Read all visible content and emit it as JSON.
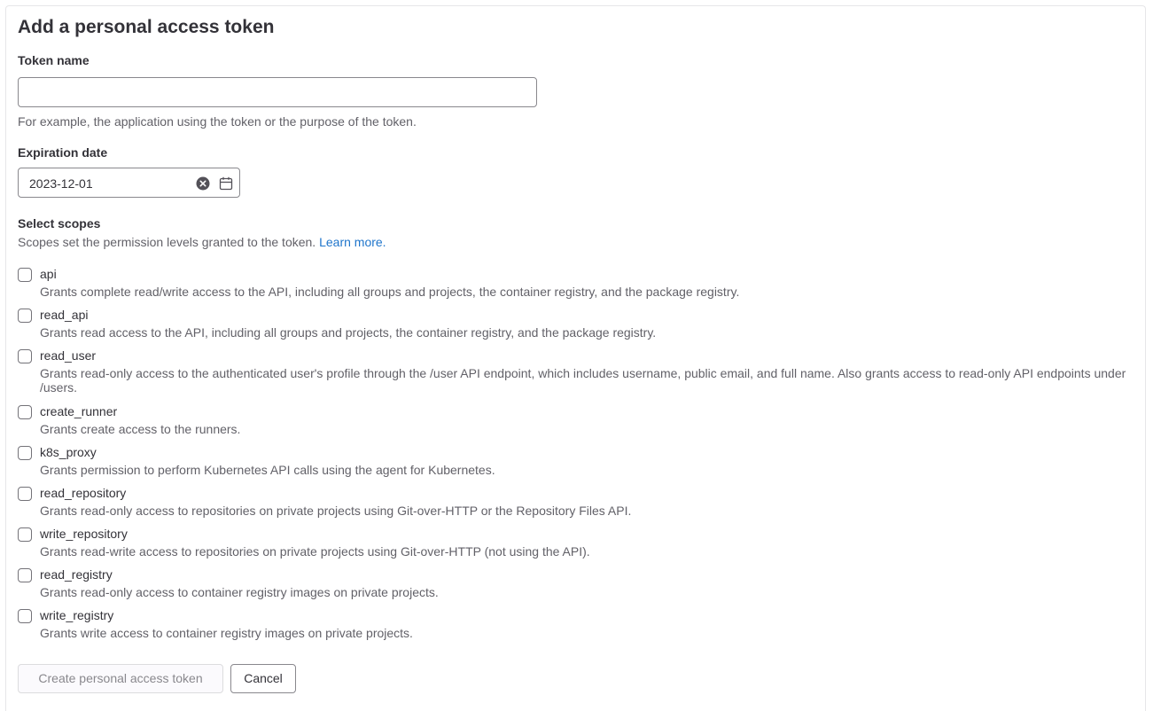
{
  "form": {
    "title": "Add a personal access token",
    "token_name": {
      "label": "Token name",
      "value": "",
      "help": "For example, the application using the token or the purpose of the token."
    },
    "expiration": {
      "label": "Expiration date",
      "value": "2023-12-01",
      "clear_icon": "clear-circle-icon",
      "calendar_icon": "calendar-icon"
    },
    "scopes": {
      "label": "Select scopes",
      "help": "Scopes set the permission levels granted to the token.",
      "learn_more": "Learn more.",
      "items": [
        {
          "name": "api",
          "checked": false,
          "desc": "Grants complete read/write access to the API, including all groups and projects, the container registry, and the package registry."
        },
        {
          "name": "read_api",
          "checked": false,
          "desc": "Grants read access to the API, including all groups and projects, the container registry, and the package registry."
        },
        {
          "name": "read_user",
          "checked": false,
          "desc": "Grants read-only access to the authenticated user's profile through the /user API endpoint, which includes username, public email, and full name. Also grants access to read-only API endpoints under /users."
        },
        {
          "name": "create_runner",
          "checked": false,
          "desc": "Grants create access to the runners."
        },
        {
          "name": "k8s_proxy",
          "checked": false,
          "desc": "Grants permission to perform Kubernetes API calls using the agent for Kubernetes."
        },
        {
          "name": "read_repository",
          "checked": false,
          "desc": "Grants read-only access to repositories on private projects using Git-over-HTTP or the Repository Files API."
        },
        {
          "name": "write_repository",
          "checked": false,
          "desc": "Grants read-write access to repositories on private projects using Git-over-HTTP (not using the API)."
        },
        {
          "name": "read_registry",
          "checked": false,
          "desc": "Grants read-only access to container registry images on private projects."
        },
        {
          "name": "write_registry",
          "checked": false,
          "desc": "Grants write access to container registry images on private projects."
        }
      ]
    },
    "buttons": {
      "create": "Create personal access token",
      "cancel": "Cancel"
    }
  }
}
